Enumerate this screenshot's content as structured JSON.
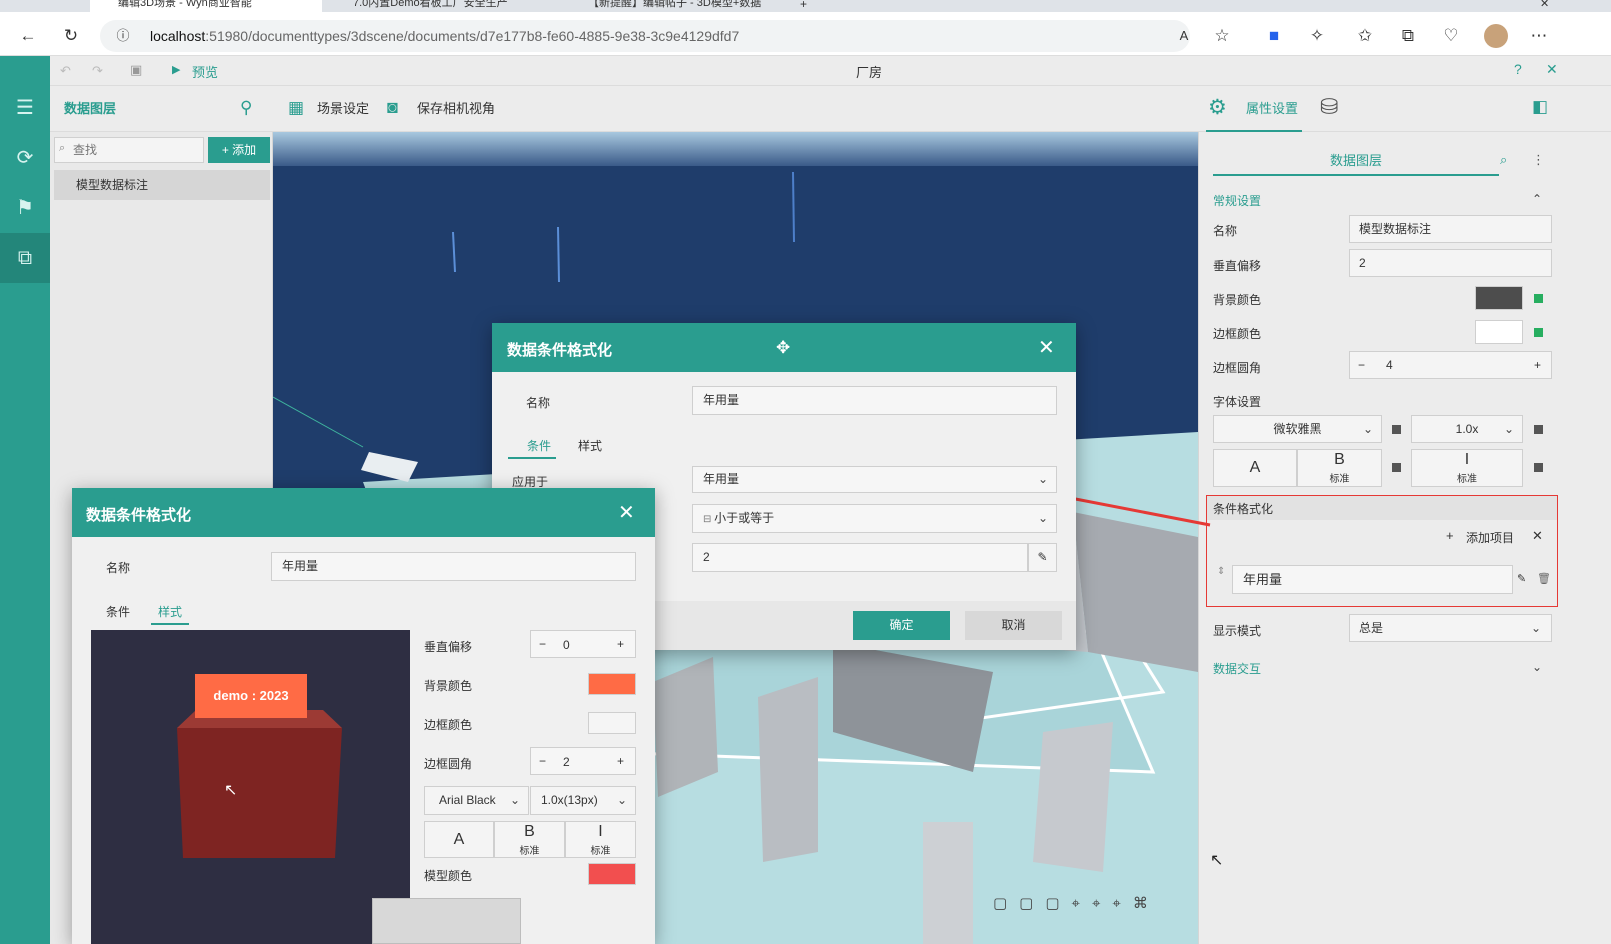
{
  "browser": {
    "tabs": [
      "编辑3D场景 - Wyn商业智能",
      "7.0内置Demo看板工厂安全生产",
      "【新提醒】编辑帖子 - 3D模型+数据"
    ],
    "url_host": "localhost",
    "url_rest": ":51980/documenttypes/3dscene/documents/d7e177b8-fe60-4885-9e38-3c9e4129dfd7"
  },
  "app": {
    "title": "厂房",
    "preview_label": "预览"
  },
  "toolbar": {
    "layers_title": "数据图层",
    "scene_settings": "场景设定",
    "save_camera": "保存相机视角",
    "property_settings": "属性设置"
  },
  "layer_panel": {
    "search_placeholder": "查找",
    "add_label": "添加",
    "items": [
      "模型数据标注"
    ]
  },
  "right_panel": {
    "tab": "数据图层",
    "general_section": "常规设置",
    "name_label": "名称",
    "name_value": "模型数据标注",
    "offset_label": "垂直偏移",
    "offset_value": "2",
    "bg_color_label": "背景颜色",
    "border_color_label": "边框颜色",
    "radius_label": "边框圆角",
    "radius_value": "4",
    "font_label": "字体设置",
    "font_family": "微软雅黑",
    "font_scale": "1.0x",
    "bold_caption": "标准",
    "italic_caption": "标准",
    "cond_section": "条件格式化",
    "add_item": "添加项目",
    "cond_item": "年用量",
    "display_mode_label": "显示模式",
    "display_mode_value": "总是",
    "interaction_section": "数据交互",
    "colors": {
      "bg": "#4d4d4d",
      "border": "#ffffff",
      "status": "#27ae60"
    }
  },
  "dialog_main": {
    "title": "数据条件格式化",
    "name_label": "名称",
    "name_value": "年用量",
    "tab_condition": "条件",
    "tab_style": "样式",
    "apply_label": "应用于",
    "apply_value": "年用量",
    "operator_value": "小于或等于",
    "threshold_value": "2",
    "ok_label": "确定",
    "cancel_label": "取消"
  },
  "dialog_style": {
    "title": "数据条件格式化",
    "name_label": "名称",
    "name_value": "年用量",
    "tab_condition": "条件",
    "tab_style": "样式",
    "preview_label": "demo : 2023",
    "offset_label": "垂直偏移",
    "offset_value": "0",
    "bg_label": "背景颜色",
    "border_label": "边框颜色",
    "radius_label": "边框圆角",
    "radius_value": "2",
    "font_family": "Arial Black",
    "font_scale": "1.0x(13px)",
    "bold_caption": "标准",
    "italic_caption": "标准",
    "model_color_label": "模型颜色",
    "colors": {
      "bg": "#ff6b45",
      "border": "#f5f5f5",
      "model": "#f24f4f",
      "label_bg": "#ff6b45",
      "cube": "#7e2422"
    }
  }
}
